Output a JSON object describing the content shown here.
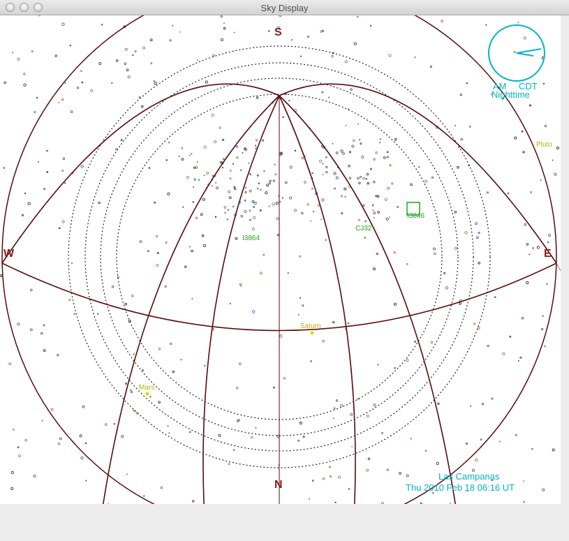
{
  "window": {
    "title": "Sky Display"
  },
  "compass": {
    "south": "S",
    "north": "N",
    "west": "W",
    "east": "E"
  },
  "clock": {
    "ampm": "AM",
    "timezone": "CDT",
    "period": "Nighttime"
  },
  "objects": {
    "pluto": "Pluto",
    "saturn": "Saturn",
    "mars": "Mars",
    "ic3": "I3864",
    "ic2": "CJ32",
    "ic1": "I3846"
  },
  "location": {
    "site": "Las Campanas",
    "datetime": "Thu  2010 Feb 18  06:16 UT"
  },
  "colors": {
    "grid": "#6b0f0f",
    "compass": "#8b1a1a",
    "cyan": "#00b4c8",
    "planet": "#d8d800",
    "object": "#1ea41e"
  }
}
